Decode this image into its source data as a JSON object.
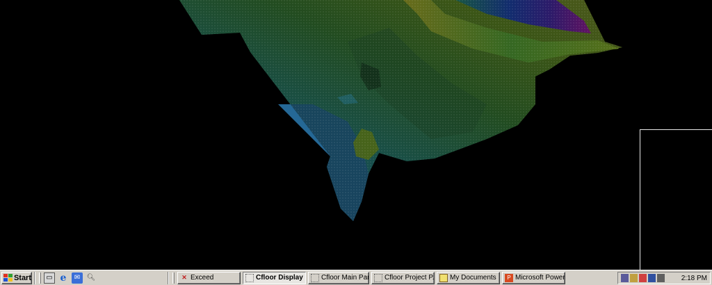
{
  "viewport": {
    "content": "3D point-cloud terrain surface",
    "palette": [
      "#2c7fa8",
      "#2a9a8a",
      "#4aa040",
      "#8ab828",
      "#c8c830",
      "#2030c0",
      "#9020b0"
    ]
  },
  "taskbar": {
    "start_label": "Start",
    "quick_launch": [
      {
        "name": "show-desktop-icon"
      },
      {
        "name": "internet-explorer-icon"
      },
      {
        "name": "outlook-icon"
      },
      {
        "name": "search-icon"
      }
    ],
    "tasks": [
      {
        "label": "Exceed",
        "icon": "x",
        "active": false
      },
      {
        "label": "Cfloor Display ...",
        "icon": "dots",
        "active": true
      },
      {
        "label": "Cfloor Main Panel",
        "icon": "dots",
        "active": false
      },
      {
        "label": "Cfloor Project P...",
        "icon": "dots",
        "active": false
      },
      {
        "label": "My Documents",
        "icon": "docs",
        "active": false
      },
      {
        "label": "Microsoft Power...",
        "icon": "ppt",
        "active": false
      }
    ],
    "clock": "2:18 PM"
  }
}
